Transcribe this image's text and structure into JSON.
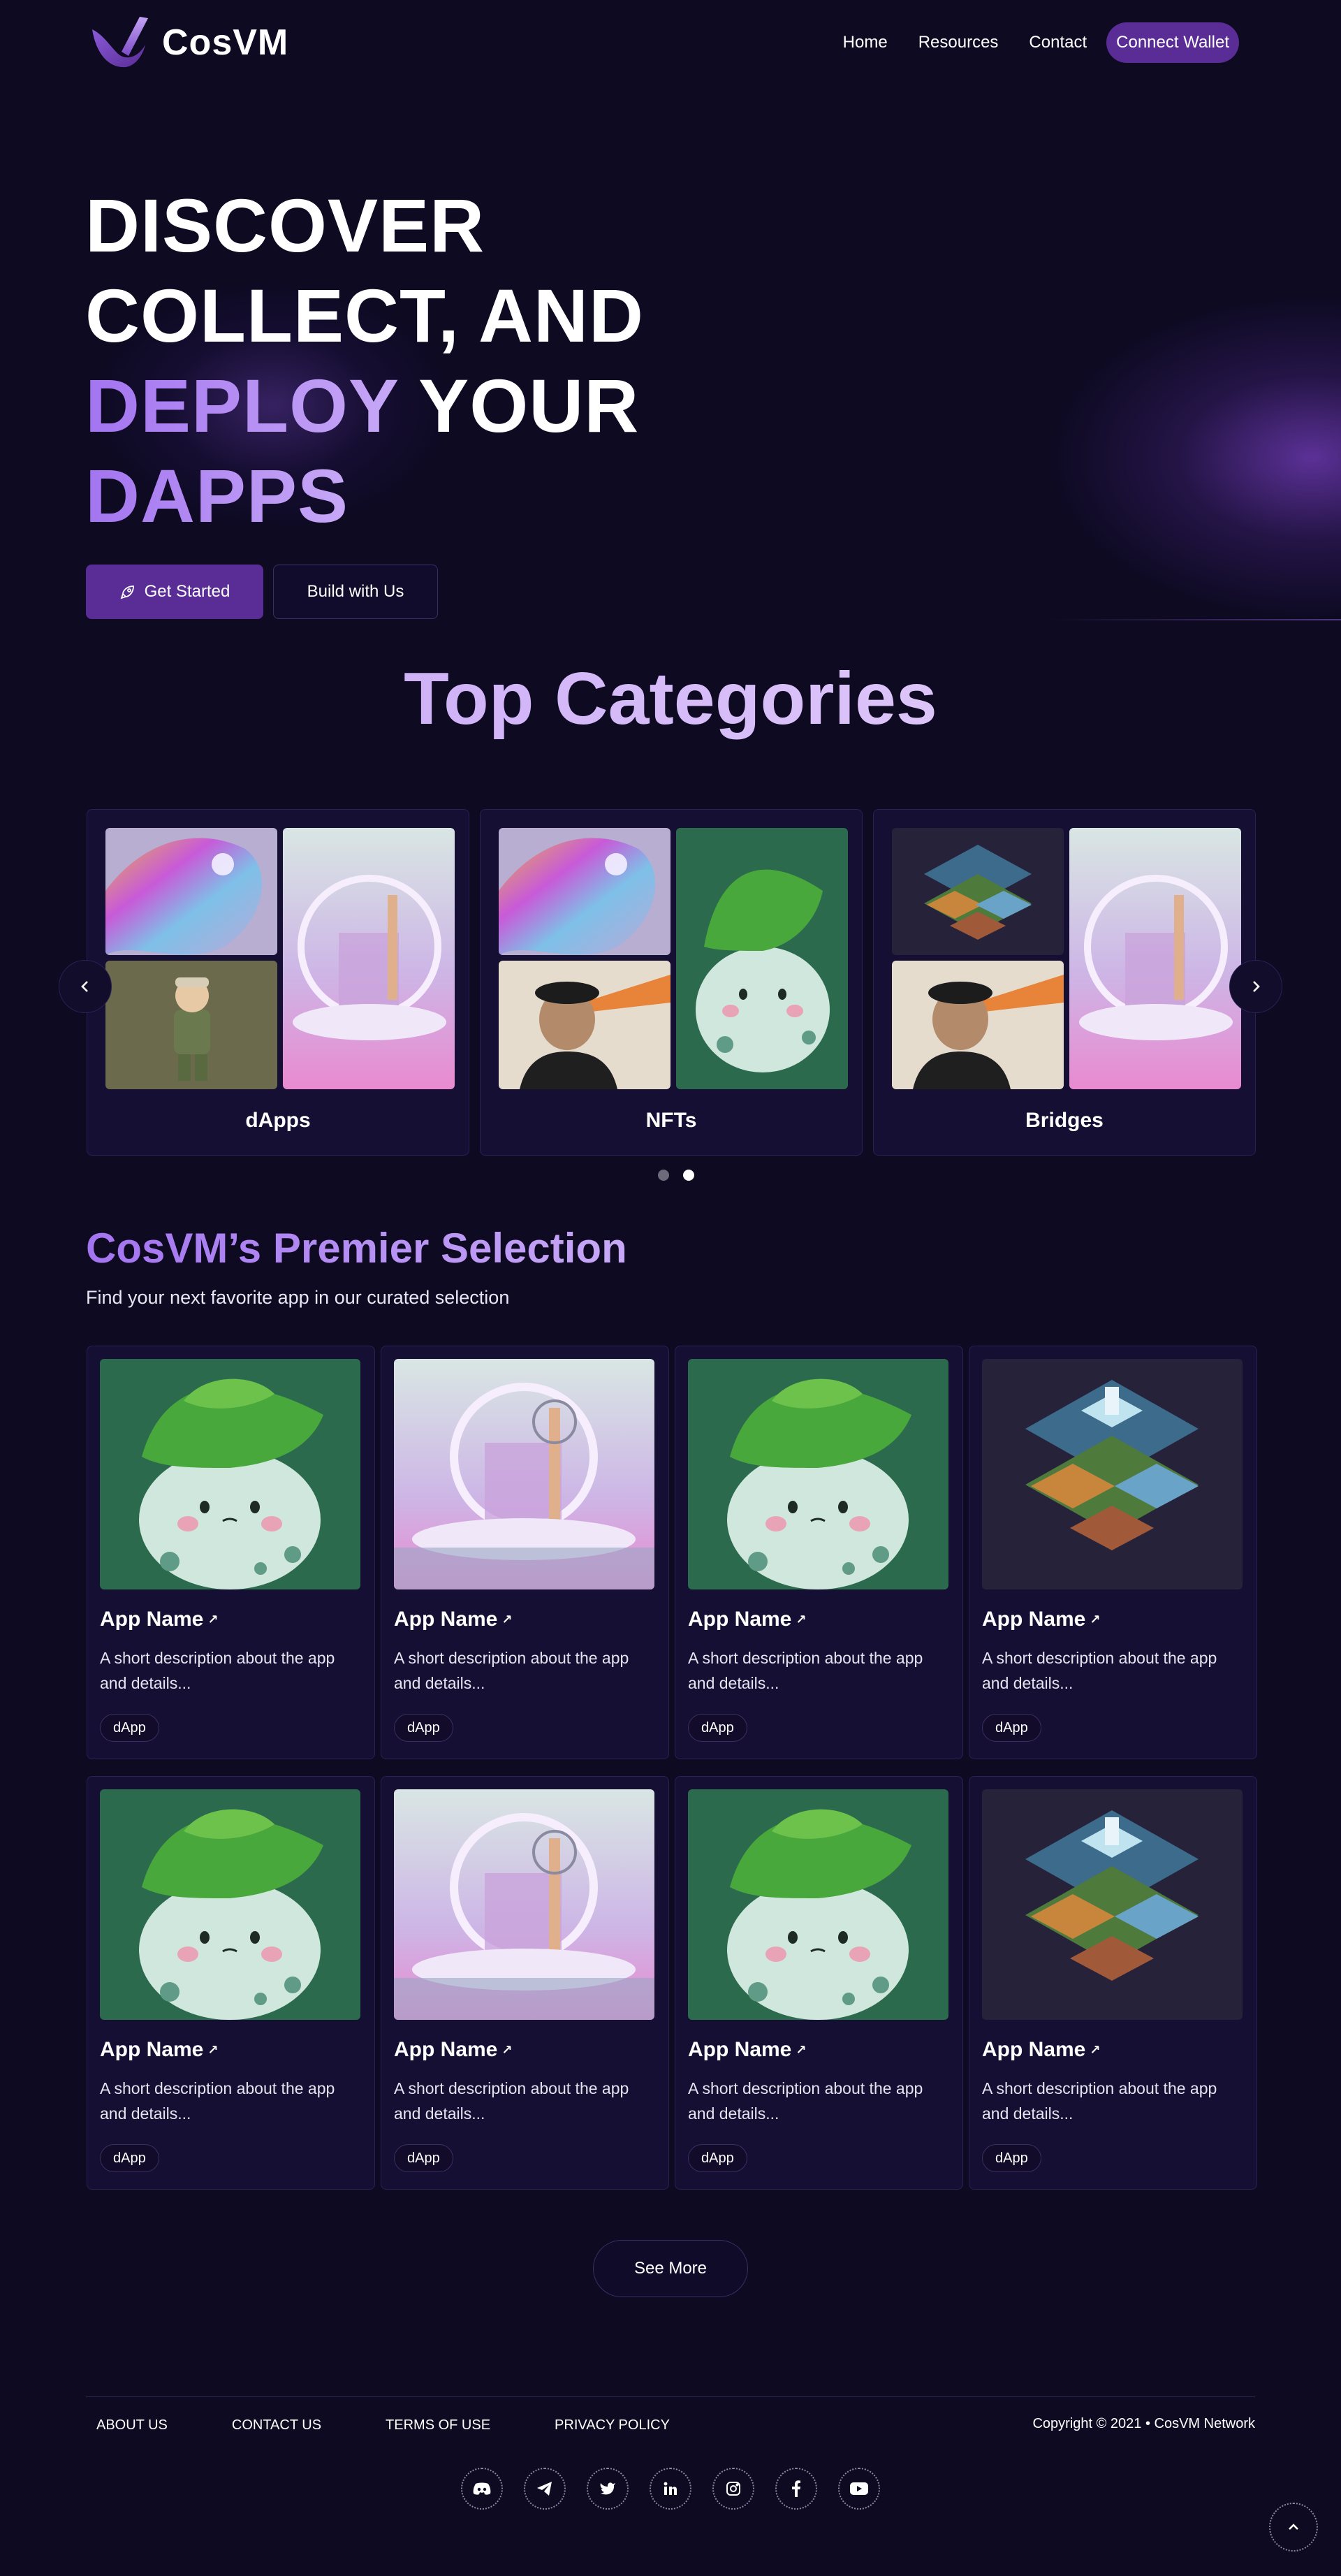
{
  "brand": {
    "name": "CosVM"
  },
  "nav": {
    "links": [
      "Home",
      "Resources",
      "Contact"
    ],
    "connect_label": "Connect Wallet"
  },
  "hero": {
    "line1": "DISCOVER",
    "line2": "COLLECT, AND",
    "line3_accent": "DEPLOY",
    "line3_rest": " YOUR",
    "line4_accent": "DAPPS",
    "primary_label": "Get Started",
    "secondary_label": "Build with Us"
  },
  "categories": {
    "title": "Top Categories",
    "items": [
      {
        "label": "dApps"
      },
      {
        "label": "NFTs"
      },
      {
        "label": "Bridges"
      }
    ],
    "active_dot": 2
  },
  "premier": {
    "title": "CosVM’s Premier Selection",
    "subtitle": "Find your next favorite app in our curated selection",
    "apps": [
      {
        "name": "App Name",
        "description": "A short description about the app and details...",
        "tag": "dApp",
        "image": "plant-creature"
      },
      {
        "name": "App Name",
        "description": "A short description about the app and details...",
        "tag": "dApp",
        "image": "dream-island"
      },
      {
        "name": "App Name",
        "description": "A short description about the app and details...",
        "tag": "dApp",
        "image": "plant-creature"
      },
      {
        "name": "App Name",
        "description": "A short description about the app and details...",
        "tag": "dApp",
        "image": "isometric-city"
      },
      {
        "name": "App Name",
        "description": "A short description about the app and details...",
        "tag": "dApp",
        "image": "plant-creature"
      },
      {
        "name": "App Name",
        "description": "A short description about the app and details...",
        "tag": "dApp",
        "image": "dream-island"
      },
      {
        "name": "App Name",
        "description": "A short description about the app and details...",
        "tag": "dApp",
        "image": "plant-creature"
      },
      {
        "name": "App Name",
        "description": "A short description about the app and details...",
        "tag": "dApp",
        "image": "isometric-city"
      }
    ],
    "see_more_label": "See More"
  },
  "footer": {
    "links": [
      "ABOUT US",
      "CONTACT US",
      "TERMS OF USE",
      "PRIVACY POLICY"
    ],
    "copyright": "Copyright © 2021 • CosVM Network",
    "socials": [
      "discord-icon",
      "telegram-icon",
      "twitter-icon",
      "linkedin-icon",
      "instagram-icon",
      "facebook-icon",
      "youtube-icon"
    ]
  },
  "colors": {
    "background": "#0d0a22",
    "accent": "#5a2c96",
    "accent_text": "#a374f0",
    "card": "#150f33"
  }
}
